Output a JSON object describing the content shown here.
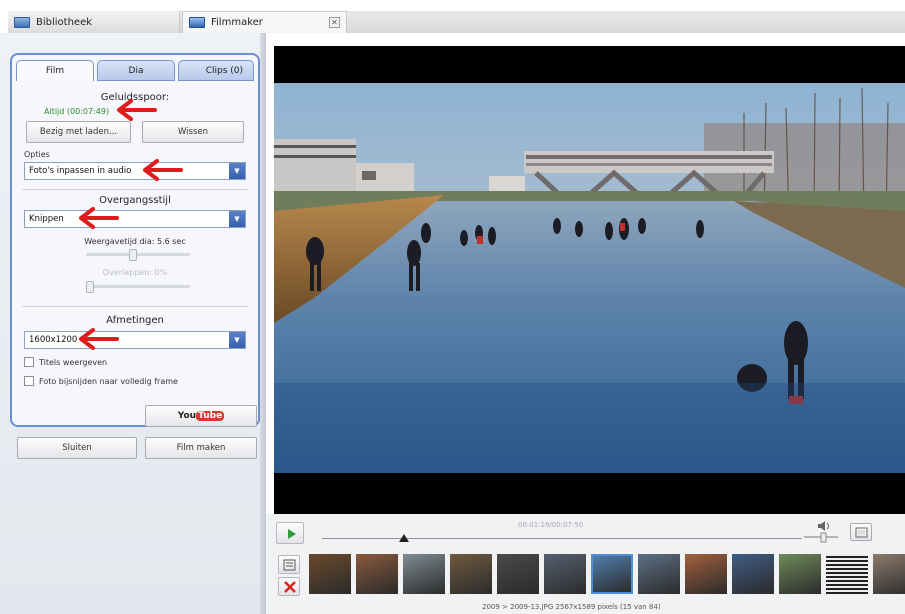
{
  "tabs": [
    {
      "label": "Bibliotheek",
      "icon": "grid-photos-icon"
    },
    {
      "label": "Filmmaker",
      "icon": "film-icon",
      "close_icon": "close-icon"
    }
  ],
  "subtabs": [
    "Film",
    "Dia",
    "Clips (0)"
  ],
  "film": {
    "audio_title": "Geluidsspoor:",
    "audio_value": "Altijd (00:07:49)",
    "load_button": "Bezig met laden...",
    "clear_button": "Wissen",
    "options_label": "Opties",
    "options_select": "Foto's inpassen in audio",
    "transition_title": "Overgangsstijl",
    "transition_select": "Knippen",
    "display_time": "Weergavetijd dia: 5.6 sec",
    "display_time_value": 0.45,
    "overlap": "Overlappen: 0%",
    "overlap_value": 0.0,
    "dimensions_title": "Afmetingen",
    "dimensions_select": "1600x1200",
    "check_titles": "Titels weergeven",
    "check_crop": "Foto bijsnijden naar volledig frame"
  },
  "buttons": {
    "youtube_you": "You",
    "youtube_tube": "Tube",
    "close": "Sluiten",
    "make_movie": "Film maken"
  },
  "player": {
    "timecode": "00:01:19/00:07:50",
    "progress": 0.17
  },
  "filmstrip": {
    "thumb_count": 13,
    "selected_index": 6,
    "status": "2009 > 2009-13.JPG   2567x1589 pixels   (15 van 84)"
  },
  "colors": {
    "accent": "#6b8fd2",
    "green_text": "#2e8b2e",
    "annotation_arrow": "#e01b1b",
    "youtube_red": "#d43a2f"
  }
}
